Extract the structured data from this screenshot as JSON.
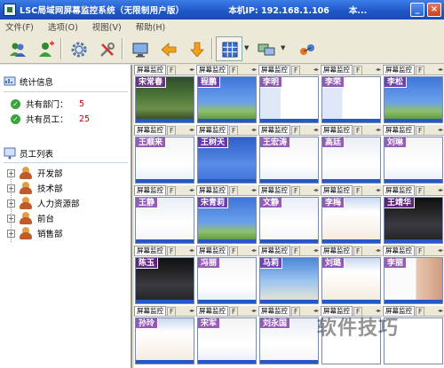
{
  "window": {
    "title": "LSC局域网屏幕监控系统（无限制用户版）",
    "ip_label": "本机IP: 192.168.1.106",
    "title_more": "本...",
    "min_glyph": "_",
    "close_glyph": "×"
  },
  "menu": [
    "文件(F)",
    "选项(O)",
    "视图(V)",
    "帮助(H)"
  ],
  "toolbar": {
    "icons": [
      "users-icon",
      "user-add-icon",
      "gear-icon",
      "tools-icon",
      "monitor-icon",
      "arrow-left-icon",
      "arrow-down-icon",
      "grid-view-icon",
      "screen-refresh-icon",
      "network-icon"
    ]
  },
  "stats": {
    "header": "统计信息",
    "departments_label": "共有部门：",
    "departments_value": "5",
    "employees_label": "共有员工：",
    "employees_value": "25"
  },
  "employees": {
    "header": "员工列表",
    "departments": [
      "开发部",
      "技术部",
      "人力资源部",
      "前台",
      "销售部"
    ]
  },
  "grid": {
    "tab_label": "屏幕监控",
    "tab2_label": "F",
    "arrows": "◂▸",
    "cells": [
      {
        "name": "宋常春",
        "theme": "forest"
      },
      {
        "name": "程鹏",
        "theme": "xp"
      },
      {
        "name": "李明",
        "theme": "desktop"
      },
      {
        "name": "李荣",
        "theme": "desktop"
      },
      {
        "name": "李松",
        "theme": "xp"
      },
      {
        "name": "王顺来",
        "theme": "doc"
      },
      {
        "name": "王树天",
        "theme": "xpblue"
      },
      {
        "name": "王宏涛",
        "theme": "doc"
      },
      {
        "name": "高廷",
        "theme": "light"
      },
      {
        "name": "刘琳",
        "theme": "doc"
      },
      {
        "name": "王静",
        "theme": "light"
      },
      {
        "name": "宋青莉",
        "theme": "xp"
      },
      {
        "name": "文静",
        "theme": "light"
      },
      {
        "name": "李梅",
        "theme": "web"
      },
      {
        "name": "王靖华",
        "theme": "dark"
      },
      {
        "name": "陈玉",
        "theme": "dark"
      },
      {
        "name": "冯丽",
        "theme": "doc"
      },
      {
        "name": "马莉",
        "theme": "sky"
      },
      {
        "name": "刘璐",
        "theme": "web"
      },
      {
        "name": "李丽",
        "theme": "portrait"
      },
      {
        "name": "孙玲",
        "theme": "web"
      },
      {
        "name": "宋军",
        "theme": "doc"
      },
      {
        "name": "刘永国",
        "theme": "light"
      },
      {
        "name": "",
        "theme": "blank"
      },
      {
        "name": "",
        "theme": "blank"
      }
    ]
  },
  "watermark": "软件技巧"
}
